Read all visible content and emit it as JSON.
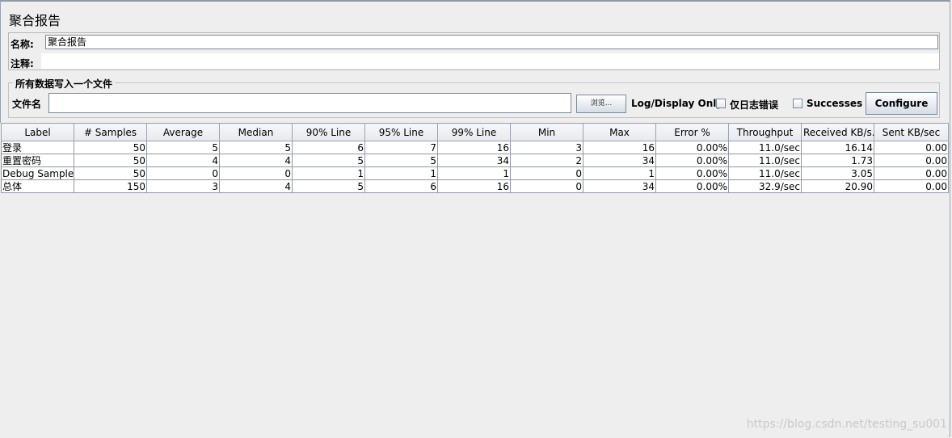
{
  "title": "聚合报告",
  "name_field": {
    "label": "名称:",
    "value": "聚合报告"
  },
  "comment_field": {
    "label": "注释:",
    "value": ""
  },
  "file_section": {
    "legend": "所有数据写入一个文件",
    "file_label": "文件名",
    "file_value": "",
    "browse_label": "浏览...",
    "log_display_label": "Log/Display Only:",
    "errors_checkbox_label": "仅日志错误",
    "errors_checked": false,
    "successes_checkbox_label": "Successes",
    "successes_checked": false,
    "configure_label": "Configure"
  },
  "table": {
    "headers": [
      "Label",
      "# Samples",
      "Average",
      "Median",
      "90% Line",
      "95% Line",
      "99% Line",
      "Min",
      "Max",
      "Error %",
      "Throughput",
      "Received KB/s...",
      "Sent KB/sec"
    ],
    "rows": [
      [
        "登录",
        "50",
        "5",
        "5",
        "6",
        "7",
        "16",
        "3",
        "16",
        "0.00%",
        "11.0/sec",
        "16.14",
        "0.00"
      ],
      [
        "重置密码",
        "50",
        "4",
        "4",
        "5",
        "5",
        "34",
        "2",
        "34",
        "0.00%",
        "11.0/sec",
        "1.73",
        "0.00"
      ],
      [
        "Debug Sampler",
        "50",
        "0",
        "0",
        "1",
        "1",
        "1",
        "0",
        "1",
        "0.00%",
        "11.0/sec",
        "3.05",
        "0.00"
      ],
      [
        "总体",
        "150",
        "3",
        "4",
        "5",
        "6",
        "16",
        "0",
        "34",
        "0.00%",
        "32.9/sec",
        "20.90",
        "0.00"
      ]
    ]
  },
  "watermark": "https://blog.csdn.net/testing_su001"
}
